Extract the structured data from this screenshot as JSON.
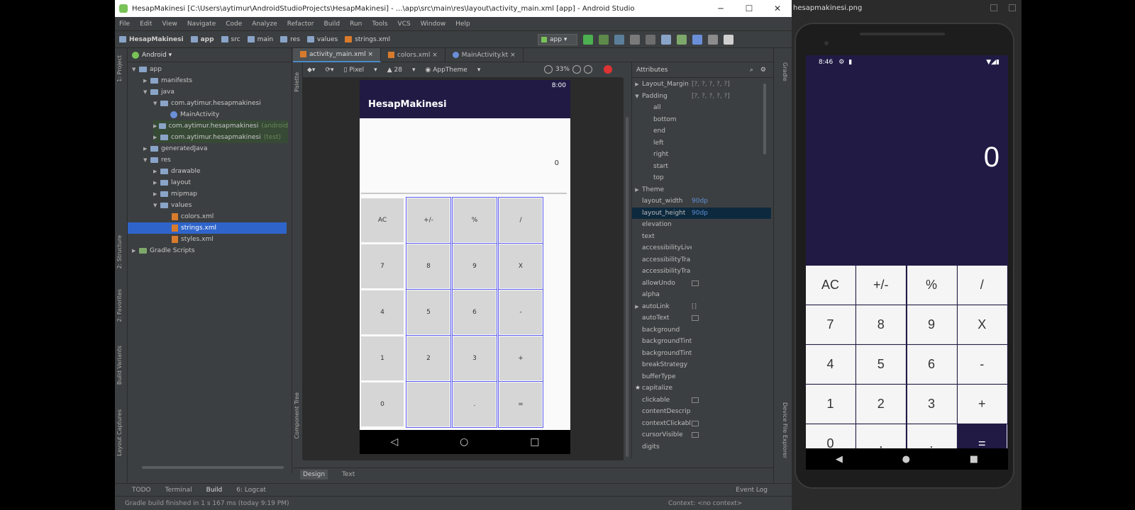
{
  "studio": {
    "title": "HesapMakinesi [C:\\Users\\aytimur\\AndroidStudioProjects\\HesapMakinesi] - ...\\app\\src\\main\\res\\layout\\activity_main.xml [app] - Android Studio",
    "menu": [
      "File",
      "Edit",
      "View",
      "Navigate",
      "Code",
      "Analyze",
      "Refactor",
      "Build",
      "Run",
      "Tools",
      "VCS",
      "Window",
      "Help"
    ],
    "breadcrumbs": [
      "HesapMakinesi",
      "app",
      "src",
      "main",
      "res",
      "values",
      "strings.xml"
    ],
    "run_config": "app",
    "project_view": "Android",
    "left_tabs": [
      "1: Project",
      "2: Structure",
      "2: Favorites",
      "Build Variants",
      "Layout Captures"
    ],
    "tree": [
      {
        "label": "app",
        "suffix": ""
      },
      {
        "label": "manifests",
        "suffix": ""
      },
      {
        "label": "java",
        "suffix": ""
      },
      {
        "label": "com.aytimur.hesapmakinesi",
        "suffix": ""
      },
      {
        "label": "MainActivity",
        "suffix": ""
      },
      {
        "label": "com.aytimur.hesapmakinesi",
        "suffix": "(android"
      },
      {
        "label": "com.aytimur.hesapmakinesi",
        "suffix": "(test)"
      },
      {
        "label": "generatedJava",
        "suffix": ""
      },
      {
        "label": "res",
        "suffix": ""
      },
      {
        "label": "drawable",
        "suffix": ""
      },
      {
        "label": "layout",
        "suffix": ""
      },
      {
        "label": "mipmap",
        "suffix": ""
      },
      {
        "label": "values",
        "suffix": ""
      },
      {
        "label": "colors.xml",
        "suffix": ""
      },
      {
        "label": "strings.xml",
        "suffix": ""
      },
      {
        "label": "styles.xml",
        "suffix": ""
      },
      {
        "label": "Gradle Scripts",
        "suffix": ""
      }
    ],
    "editor_tabs": [
      "activity_main.xml",
      "colors.xml",
      "MainActivity.kt"
    ],
    "design_toolbar": {
      "device": "Pixel",
      "api": "28",
      "theme": "AppTheme",
      "zoom": "33%"
    },
    "palette_label": "Palette",
    "component_tree_label": "Component Tree",
    "preview": {
      "status_time": "8:00",
      "app_title": "HesapMakinesi",
      "display_value": "0",
      "buttons": [
        "AC",
        "+/-",
        "%",
        "/",
        "7",
        "8",
        "9",
        "X",
        "4",
        "5",
        "6",
        "-",
        "1",
        "2",
        "3",
        "+",
        "0",
        "",
        ".",
        "="
      ]
    },
    "attributes": {
      "header": "Attributes",
      "rows": [
        {
          "name": "Layout_Margin",
          "value": "[?, ?, ?, ?, ?]"
        },
        {
          "name": "Padding",
          "value": "[?, ?, ?, ?, ?]"
        },
        {
          "name": "all",
          "value": ""
        },
        {
          "name": "bottom",
          "value": ""
        },
        {
          "name": "end",
          "value": ""
        },
        {
          "name": "left",
          "value": ""
        },
        {
          "name": "right",
          "value": ""
        },
        {
          "name": "start",
          "value": ""
        },
        {
          "name": "top",
          "value": ""
        },
        {
          "name": "Theme",
          "value": ""
        },
        {
          "name": "layout_width",
          "value": "90dp"
        },
        {
          "name": "layout_height",
          "value": "90dp"
        },
        {
          "name": "elevation",
          "value": ""
        },
        {
          "name": "text",
          "value": ""
        },
        {
          "name": "accessibilityLive",
          "value": ""
        },
        {
          "name": "accessibilityTra",
          "value": ""
        },
        {
          "name": "accessibilityTra",
          "value": ""
        },
        {
          "name": "allowUndo",
          "value": ""
        },
        {
          "name": "alpha",
          "value": ""
        },
        {
          "name": "autoLink",
          "value": "[]"
        },
        {
          "name": "autoText",
          "value": ""
        },
        {
          "name": "background",
          "value": ""
        },
        {
          "name": "backgroundTint",
          "value": ""
        },
        {
          "name": "backgroundTint",
          "value": ""
        },
        {
          "name": "breakStrategy",
          "value": ""
        },
        {
          "name": "bufferType",
          "value": ""
        },
        {
          "name": "capitalize",
          "value": ""
        },
        {
          "name": "clickable",
          "value": ""
        },
        {
          "name": "contentDescrip",
          "value": ""
        },
        {
          "name": "contextClickabl",
          "value": ""
        },
        {
          "name": "cursorVisible",
          "value": ""
        },
        {
          "name": "digits",
          "value": ""
        }
      ]
    },
    "right_tabs": [
      "Gradle",
      "Device File Explorer"
    ],
    "bottom_tabs": [
      "Design",
      "Text"
    ],
    "tool_tabs": [
      "TODO",
      "Terminal",
      "Build",
      "6: Logcat"
    ],
    "event_log": "Event Log",
    "status": "Gradle build finished in 1 s 167 ms (today 9:19 PM)",
    "context": "Context: <no context>"
  },
  "emulator": {
    "title": "hesapmakinesi.png",
    "status_time": "8:46",
    "display_value": "0",
    "keys": [
      "AC",
      "+/-",
      "%",
      "/",
      "7",
      "8",
      "9",
      "X",
      "4",
      "5",
      "6",
      "-",
      "1",
      "2",
      "3",
      "+",
      "0",
      ",",
      ".",
      "="
    ]
  },
  "colors": {
    "ide_bg": "#3c3f41",
    "selection": "#2f65ca",
    "app_primary": "#201a45",
    "key_bg": "#f5f5f5",
    "preview_button": "#d6d6d6"
  }
}
